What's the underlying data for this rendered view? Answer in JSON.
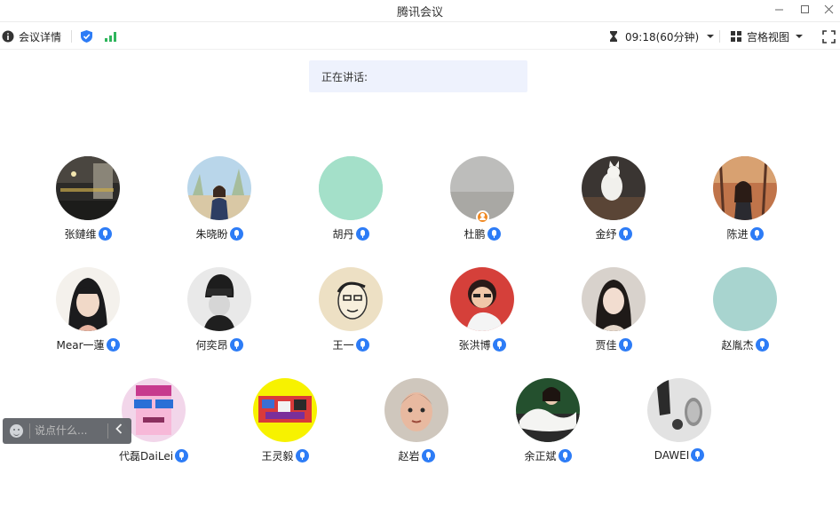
{
  "window": {
    "title": "腾讯会议"
  },
  "toolbar": {
    "meeting_info_label": "会议详情",
    "timer": "09:18(60分钟)",
    "view_label": "宫格视图"
  },
  "speaking": {
    "label": "正在讲话:"
  },
  "participants": [
    {
      "name": "张鏈维",
      "avatar": "night-street-photo"
    },
    {
      "name": "朱晓盼",
      "avatar": "girl-outdoor-photo"
    },
    {
      "name": "胡丹",
      "avatar": "mint-placeholder"
    },
    {
      "name": "杜鹏",
      "avatar": "grey-sky-photo",
      "host": true
    },
    {
      "name": "金纾",
      "avatar": "white-cat-photo"
    },
    {
      "name": "陈进",
      "avatar": "autumn-portrait-photo"
    },
    {
      "name": "Mear一蓮",
      "avatar": "girl-portrait-photo"
    },
    {
      "name": "何奕昂",
      "avatar": "child-bw-photo"
    },
    {
      "name": "王一",
      "avatar": "sketch-face-drawing"
    },
    {
      "name": "张洪博",
      "avatar": "red-cartoon-avatar"
    },
    {
      "name": "贾佳",
      "avatar": "woman-portrait-photo"
    },
    {
      "name": "赵胤杰",
      "avatar": "teal-placeholder"
    },
    {
      "name": "代磊DaiLei",
      "avatar": "pixel-sunglasses-avatar"
    },
    {
      "name": "王灵毅",
      "avatar": "yellow-anime-avatar"
    },
    {
      "name": "赵岩",
      "avatar": "baby-painting-avatar"
    },
    {
      "name": "余正斌",
      "avatar": "feather-wedding-photo"
    },
    {
      "name": "DAWEI",
      "avatar": "bw-objects-photo"
    }
  ],
  "chat": {
    "placeholder": "说点什么..."
  },
  "colors": {
    "accent": "#2d7cf6",
    "host_badge": "#f08a24",
    "speaking_bg": "#eef2fd",
    "chat_bg": "#5f6368"
  }
}
